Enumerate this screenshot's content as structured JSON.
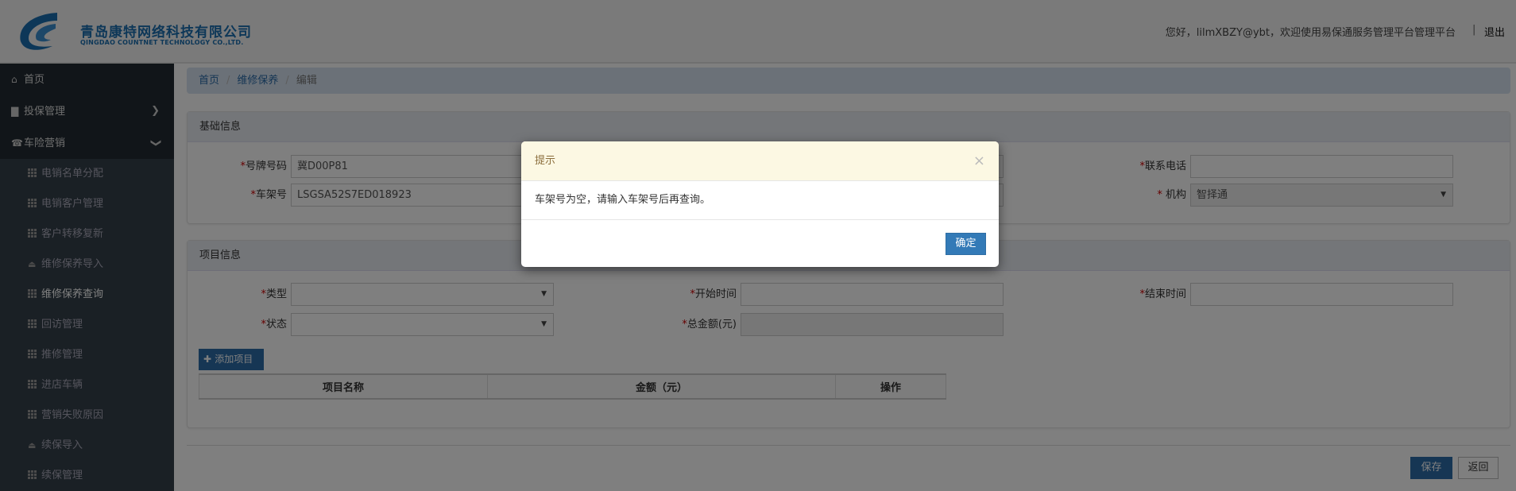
{
  "header": {
    "company_cn": "青岛康特网络科技有限公司",
    "company_en": "QINGDAO COUNTNET TECHNOLOGY CO.,LTD.",
    "greeting": "您好，lilmXBZY@ybt，欢迎使用易保通服务管理平台管理平台",
    "divider": "|",
    "logout": "退出"
  },
  "sidebar": {
    "top": [
      {
        "label": "首页",
        "icon": "home-icon"
      },
      {
        "label": "投保管理",
        "icon": "file-icon"
      },
      {
        "label": "车险营销",
        "icon": "phone-icon"
      }
    ],
    "sub": [
      {
        "label": "电销名单分配",
        "icon": "grid"
      },
      {
        "label": "电销客户管理",
        "icon": "grid"
      },
      {
        "label": "客户转移复新",
        "icon": "grid"
      },
      {
        "label": "维修保养导入",
        "icon": "upload"
      },
      {
        "label": "维修保养查询",
        "icon": "grid"
      },
      {
        "label": "回访管理",
        "icon": "grid"
      },
      {
        "label": "推修管理",
        "icon": "grid"
      },
      {
        "label": "进店车辆",
        "icon": "grid"
      },
      {
        "label": "营销失败原因",
        "icon": "grid"
      },
      {
        "label": "续保导入",
        "icon": "upload"
      },
      {
        "label": "续保管理",
        "icon": "grid"
      }
    ]
  },
  "breadcrumb": [
    "首页",
    "维修保养",
    "编辑"
  ],
  "basic": {
    "title": "基础信息",
    "plate_label": "号牌号码",
    "plate_value": "冀D00P81",
    "vin_label": "车架号",
    "vin_value": "LSGSA52S7ED018923",
    "phone_label": "联系电话",
    "phone_value": "",
    "org_label": " 机构",
    "org_value": "智择通"
  },
  "project": {
    "title": "项目信息",
    "type_label": "类型",
    "status_label": "状态",
    "start_label": "开始时间",
    "total_label": "总金额(元)",
    "end_label": "结束时间",
    "add_button": "添加项目",
    "columns": [
      "项目名称",
      "金额（元）",
      "操作"
    ]
  },
  "footer": {
    "save": "保存",
    "back": "返回"
  },
  "modal": {
    "title": "提示",
    "message": "车架号为空，请输入车架号后再查询。",
    "ok": "确定",
    "close": "×"
  },
  "required_mark": "*"
}
